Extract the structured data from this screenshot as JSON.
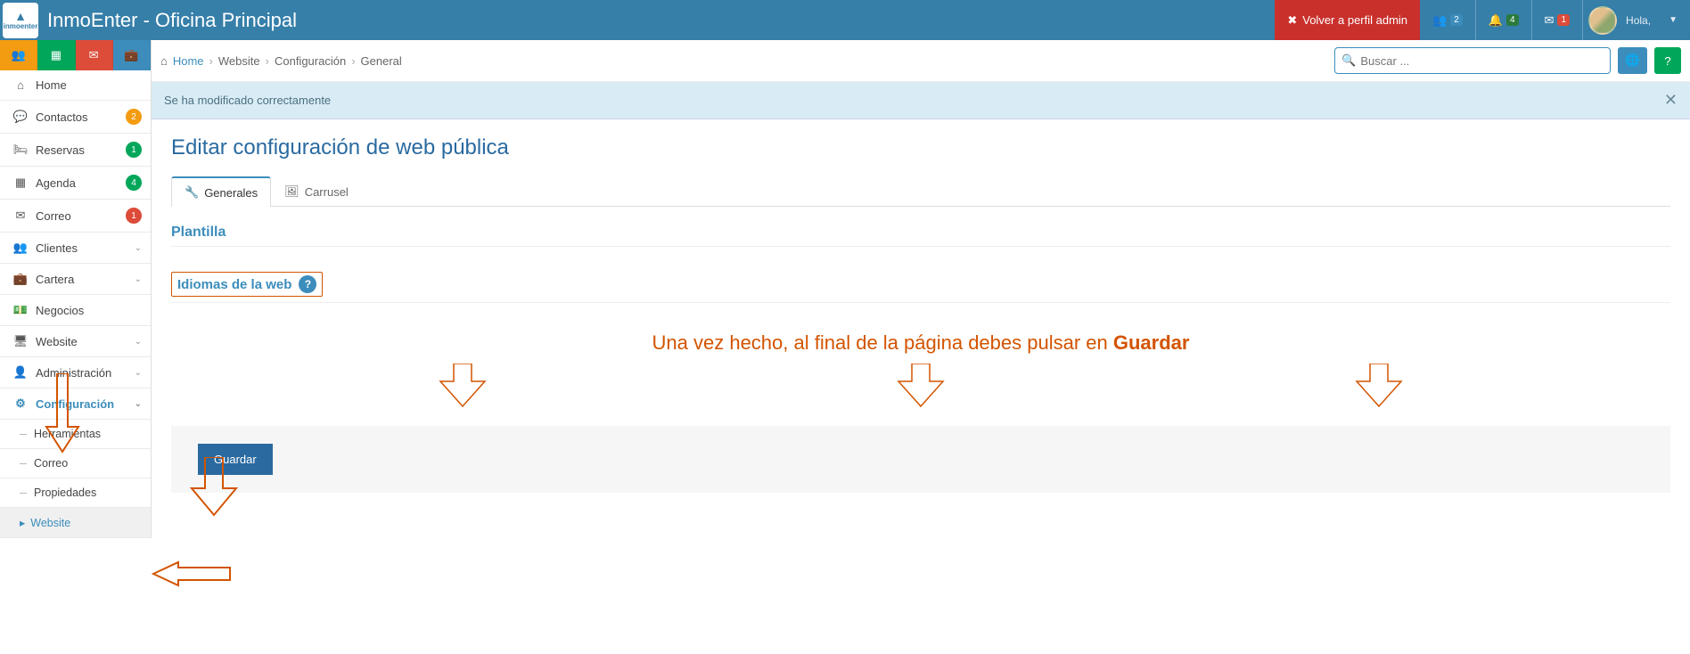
{
  "header": {
    "logo_text": "inmoenter",
    "app_title": "InmoEnter - Oficina Principal",
    "back_admin": "Volver a perfil admin",
    "badge_users": "2",
    "badge_notif": "4",
    "badge_mail": "1",
    "greeting": "Hola,"
  },
  "sidebar": {
    "items": [
      {
        "icon": "⌂",
        "label": "Home"
      },
      {
        "icon": "💬",
        "label": "Contactos",
        "badge": "2",
        "badge_cls": "nb-orange"
      },
      {
        "icon": "🛏",
        "label": "Reservas",
        "badge": "1",
        "badge_cls": "nb-green"
      },
      {
        "icon": "▦",
        "label": "Agenda",
        "badge": "4",
        "badge_cls": "nb-green"
      },
      {
        "icon": "✉",
        "label": "Correo",
        "badge": "1",
        "badge_cls": "nb-red"
      },
      {
        "icon": "👥",
        "label": "Clientes",
        "chev": true
      },
      {
        "icon": "💼",
        "label": "Cartera",
        "chev": true
      },
      {
        "icon": "💵",
        "label": "Negocios"
      },
      {
        "icon": "🖥",
        "label": "Website",
        "chev": true
      },
      {
        "icon": "👤",
        "label": "Administración",
        "chev": true
      },
      {
        "icon": "⚙",
        "label": "Configuración",
        "chev": true,
        "active": true
      }
    ],
    "sub": [
      {
        "label": "Herramientas"
      },
      {
        "label": "Correo"
      },
      {
        "label": "Propiedades"
      },
      {
        "label": "Website",
        "active": true
      }
    ]
  },
  "breadcrumb": {
    "home": "Home",
    "b1": "Website",
    "b2": "Configuración",
    "b3": "General"
  },
  "search": {
    "placeholder": "Buscar ..."
  },
  "alert": {
    "msg": "Se ha modificado correctamente",
    "close": "✕"
  },
  "page": {
    "title": "Editar configuración de web pública",
    "tab_generales": "Generales",
    "tab_carrusel": "Carrusel",
    "section_plantilla": "Plantilla",
    "section_idiomas": "Idiomas de la web",
    "annot_pre": "Una vez hecho, al final de la página debes pulsar en ",
    "annot_bold": "Guardar",
    "save": "Guardar"
  }
}
